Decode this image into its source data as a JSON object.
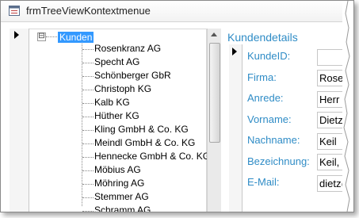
{
  "window": {
    "title": "frmTreeViewKontextmenue"
  },
  "tree": {
    "root_label": "Kunden",
    "expander_symbol": "⊟",
    "children": [
      "Rosenkranz AG",
      "Specht AG",
      "Schönberger GbR",
      "Christoph KG",
      "Kalb KG",
      "Hüther KG",
      "Kling GmbH & Co. KG",
      "Meindl GmbH & Co. KG",
      "Hennecke GmbH & Co. KG",
      "Möbius AG",
      "Möhring AG",
      "Stemmer AG",
      "Schramm AG"
    ]
  },
  "details": {
    "title": "Kundendetails",
    "fields": [
      {
        "label": "KundeID:",
        "value": ""
      },
      {
        "label": "Firma:",
        "value": "Rosenk"
      },
      {
        "label": "Anrede:",
        "value": "Herr"
      },
      {
        "label": "Vorname:",
        "value": "Dietz"
      },
      {
        "label": "Nachname:",
        "value": "Keil"
      },
      {
        "label": "Bezeichnung:",
        "value": "Keil, D"
      },
      {
        "label": "E-Mail:",
        "value": "dietz@"
      }
    ]
  },
  "colors": {
    "accent": "#2f8cc6",
    "selection": "#3399ff"
  }
}
